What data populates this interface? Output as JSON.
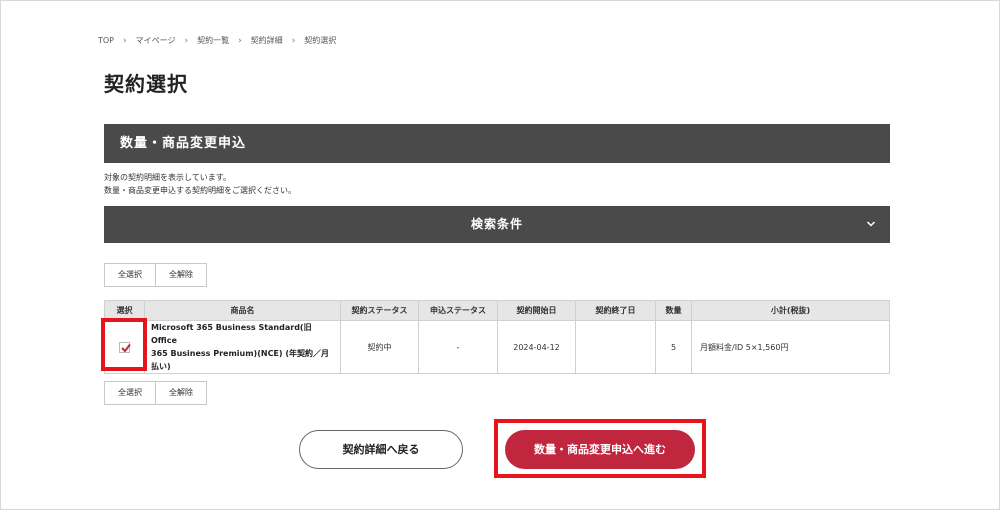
{
  "breadcrumb": [
    "TOP",
    "マイページ",
    "契約一覧",
    "契約詳細",
    "契約選択"
  ],
  "page_title": "契約選択",
  "section_title": "数量・商品変更申込",
  "description": [
    "対象の契約明細を表示しています。",
    "数量・商品変更申込する契約明細をご選択ください。"
  ],
  "search": {
    "label": "検索条件",
    "icon": "chevron-down-icon"
  },
  "selection_buttons": {
    "select_all": "全選択",
    "clear_all": "全解除"
  },
  "table": {
    "headers": [
      "選択",
      "商品名",
      "契約ステータス",
      "申込ステータス",
      "契約開始日",
      "契約終了日",
      "数量",
      "小計(税抜)"
    ],
    "rows": [
      {
        "selected": true,
        "product_line1": "Microsoft 365 Business Standard(旧Office",
        "product_line2": "365 Business Premium)(NCE) (年契約／月",
        "product_line3": "払い)",
        "contract_status": "契約中",
        "application_status": "-",
        "start_date": "2024-04-12",
        "end_date": "",
        "quantity": "5",
        "subtotal": "月額料金/ID 5×1,560円"
      }
    ]
  },
  "buttons": {
    "back": "契約詳細へ戻る",
    "next": "数量・商品変更申込へ進む"
  },
  "colors": {
    "header_bg": "#4a4a4a",
    "primary": "#c0263d",
    "highlight": "#e8141c",
    "check": "#c0263d"
  }
}
